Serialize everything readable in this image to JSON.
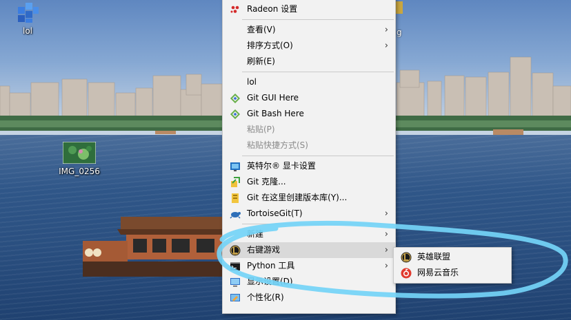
{
  "desktop": {
    "icons": [
      {
        "label": "lol"
      },
      {
        "label": "IMG_0256"
      }
    ],
    "partial_icon_text": "g"
  },
  "context_menu": {
    "items": [
      {
        "label": "Radeon 设置",
        "icon": "radeon-icon"
      },
      {
        "separator": true
      },
      {
        "label": "查看(V)",
        "submenu": true
      },
      {
        "label": "排序方式(O)",
        "submenu": true
      },
      {
        "label": "刷新(E)"
      },
      {
        "separator": true
      },
      {
        "label": "lol"
      },
      {
        "label": "Git GUI Here",
        "icon": "git-icon"
      },
      {
        "label": "Git Bash Here",
        "icon": "git-icon"
      },
      {
        "label": "粘贴(P)",
        "disabled": true
      },
      {
        "label": "粘贴快捷方式(S)",
        "disabled": true
      },
      {
        "separator": true
      },
      {
        "label": "英特尔® 显卡设置",
        "icon": "intel-graphics-icon"
      },
      {
        "label": "Git 克隆...",
        "icon": "tortoisegit-clone-icon"
      },
      {
        "label": "Git 在这里创建版本库(Y)...",
        "icon": "tortoisegit-repo-icon"
      },
      {
        "label": "TortoiseGit(T)",
        "icon": "tortoisegit-icon",
        "submenu": true
      },
      {
        "separator": true
      },
      {
        "label": "新建",
        "submenu": true
      },
      {
        "label": "右键游戏",
        "icon": "game-icon",
        "submenu": true,
        "highlighted": true
      },
      {
        "label": "Python 工具",
        "icon": "cmd-icon",
        "submenu": true
      },
      {
        "label": "显示设置(D)",
        "icon": "display-icon"
      },
      {
        "label": "个性化(R)",
        "icon": "personalize-icon"
      }
    ],
    "arrow_glyph": "›"
  },
  "sub_menu": {
    "items": [
      {
        "label": "英雄联盟",
        "icon": "league-of-legends-icon"
      },
      {
        "label": "网易云音乐",
        "icon": "netease-music-icon"
      }
    ]
  },
  "colors": {
    "menu_bg": "#f2f2f2",
    "menu_hover": "#d9d9d9",
    "scribble": "#74d4f7"
  }
}
